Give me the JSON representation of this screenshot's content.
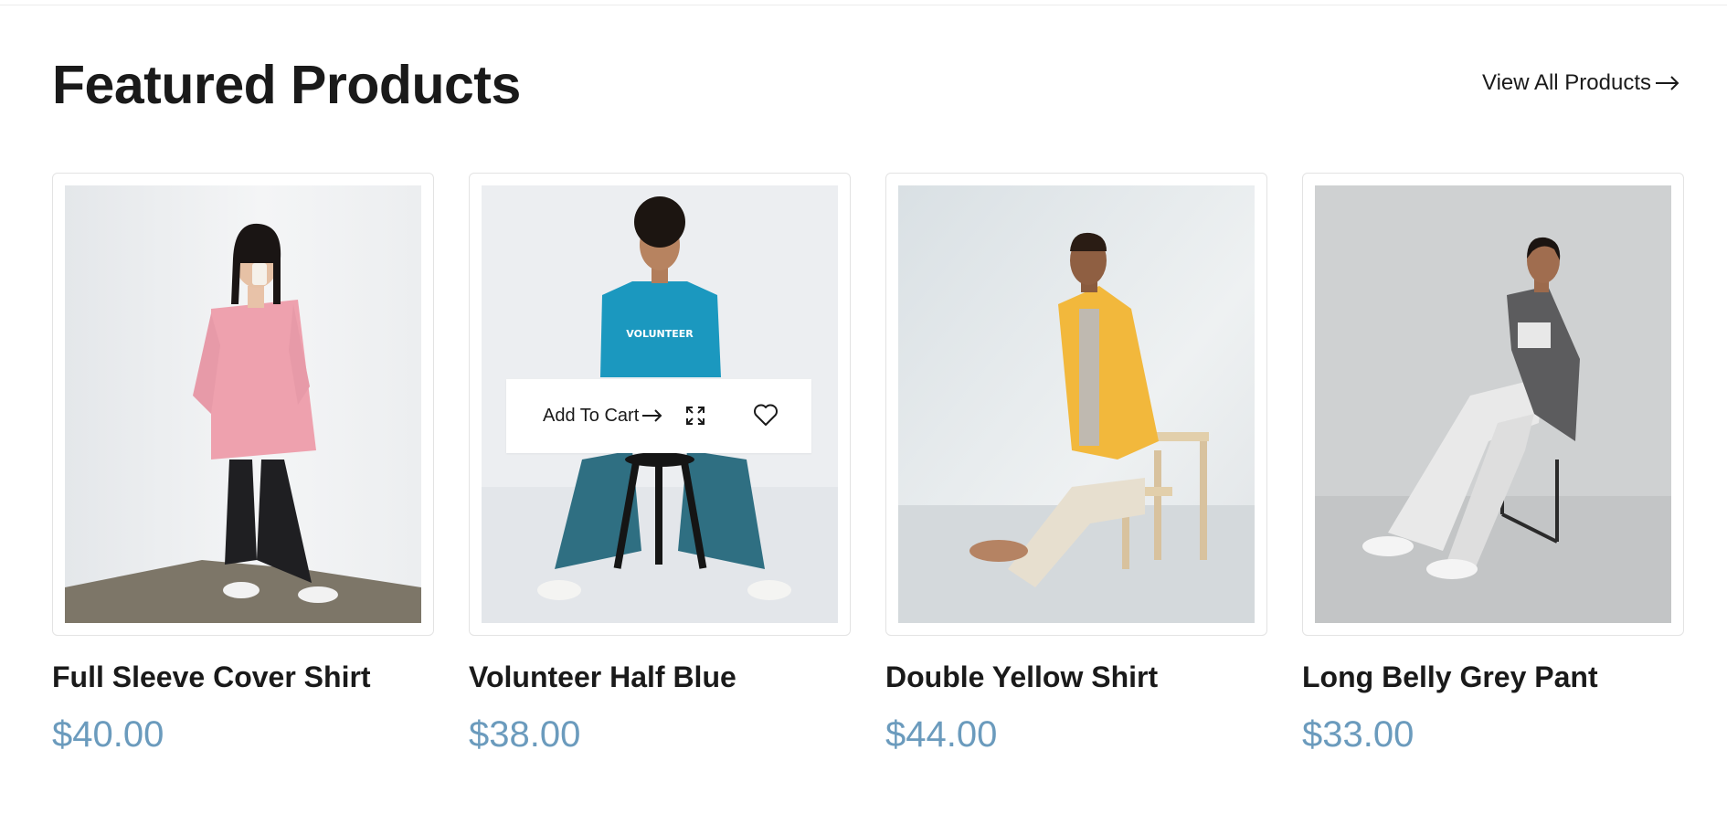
{
  "section": {
    "title": "Featured Products",
    "view_all_label": "View All Products"
  },
  "colors": {
    "price": "#6b9bbd",
    "text": "#1a1a1a",
    "card_border": "#e3e3e3"
  },
  "products": [
    {
      "name": "Full Sleeve Cover Shirt",
      "price": "$40.00"
    },
    {
      "name": "Volunteer Half Blue",
      "price": "$38.00",
      "actions": {
        "add_to_cart_label": "Add To Cart",
        "shirt_text": "VOLUNTEER"
      }
    },
    {
      "name": "Double Yellow Shirt",
      "price": "$44.00"
    },
    {
      "name": "Long Belly Grey Pant",
      "price": "$33.00"
    }
  ],
  "icons": {
    "view_all": "arrow-right-icon",
    "add_to_cart": "arrow-right-icon",
    "quick_view": "expand-icon",
    "wishlist": "heart-icon"
  }
}
